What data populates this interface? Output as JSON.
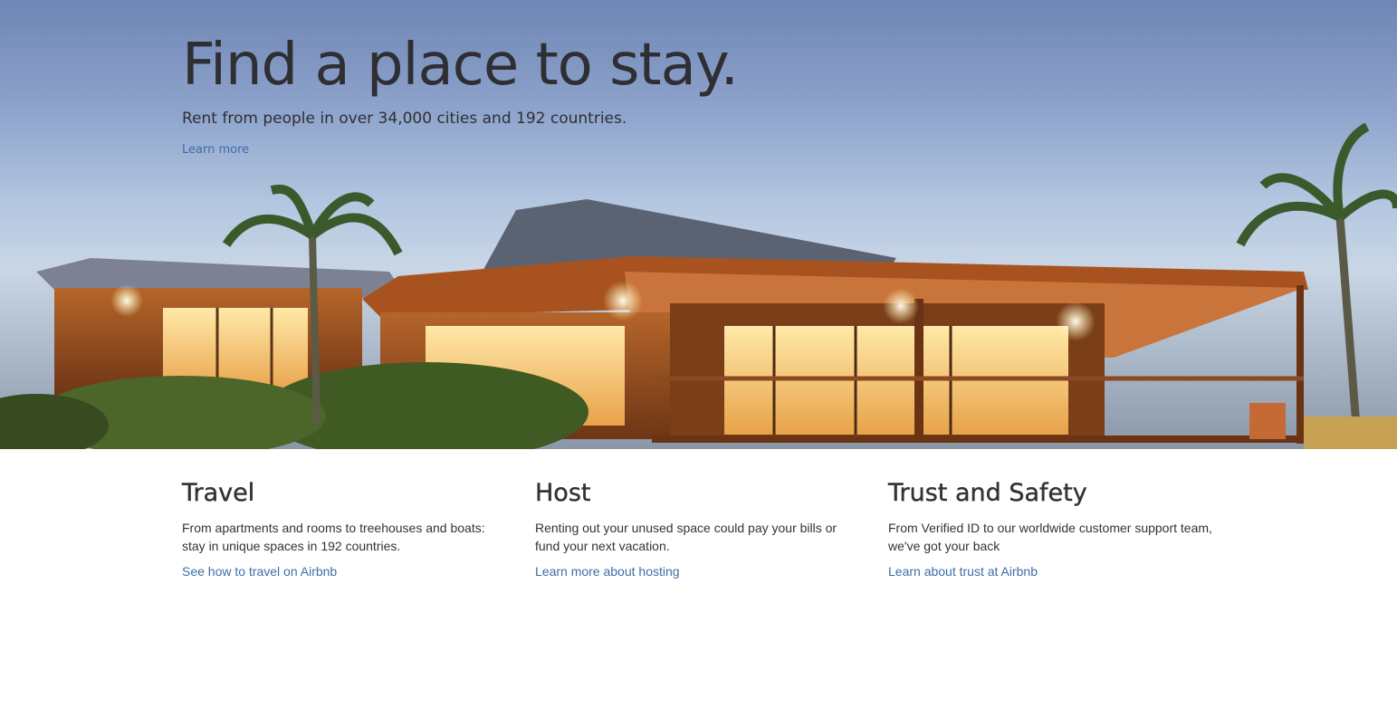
{
  "hero": {
    "title": "Find a place to stay.",
    "subtitle": "Rent from people in over 34,000 cities and 192 countries.",
    "link_label": "Learn more",
    "image": "house-at-dusk-photo"
  },
  "features": [
    {
      "title": "Travel",
      "description": "From apartments and rooms to treehouses and boats: stay in unique spaces in 192 countries.",
      "link_label": "See how to travel on Airbnb"
    },
    {
      "title": "Host",
      "description": "Renting out your unused space could pay your bills or fund your next vacation.",
      "link_label": "Learn more about hosting"
    },
    {
      "title": "Trust and Safety",
      "description": "From Verified ID to our worldwide customer support team, we've got your back",
      "link_label": "Learn about trust at Airbnb"
    }
  ],
  "colors": {
    "link": "#3d6da8",
    "text": "#333333",
    "sky": "#8ea4cc"
  }
}
